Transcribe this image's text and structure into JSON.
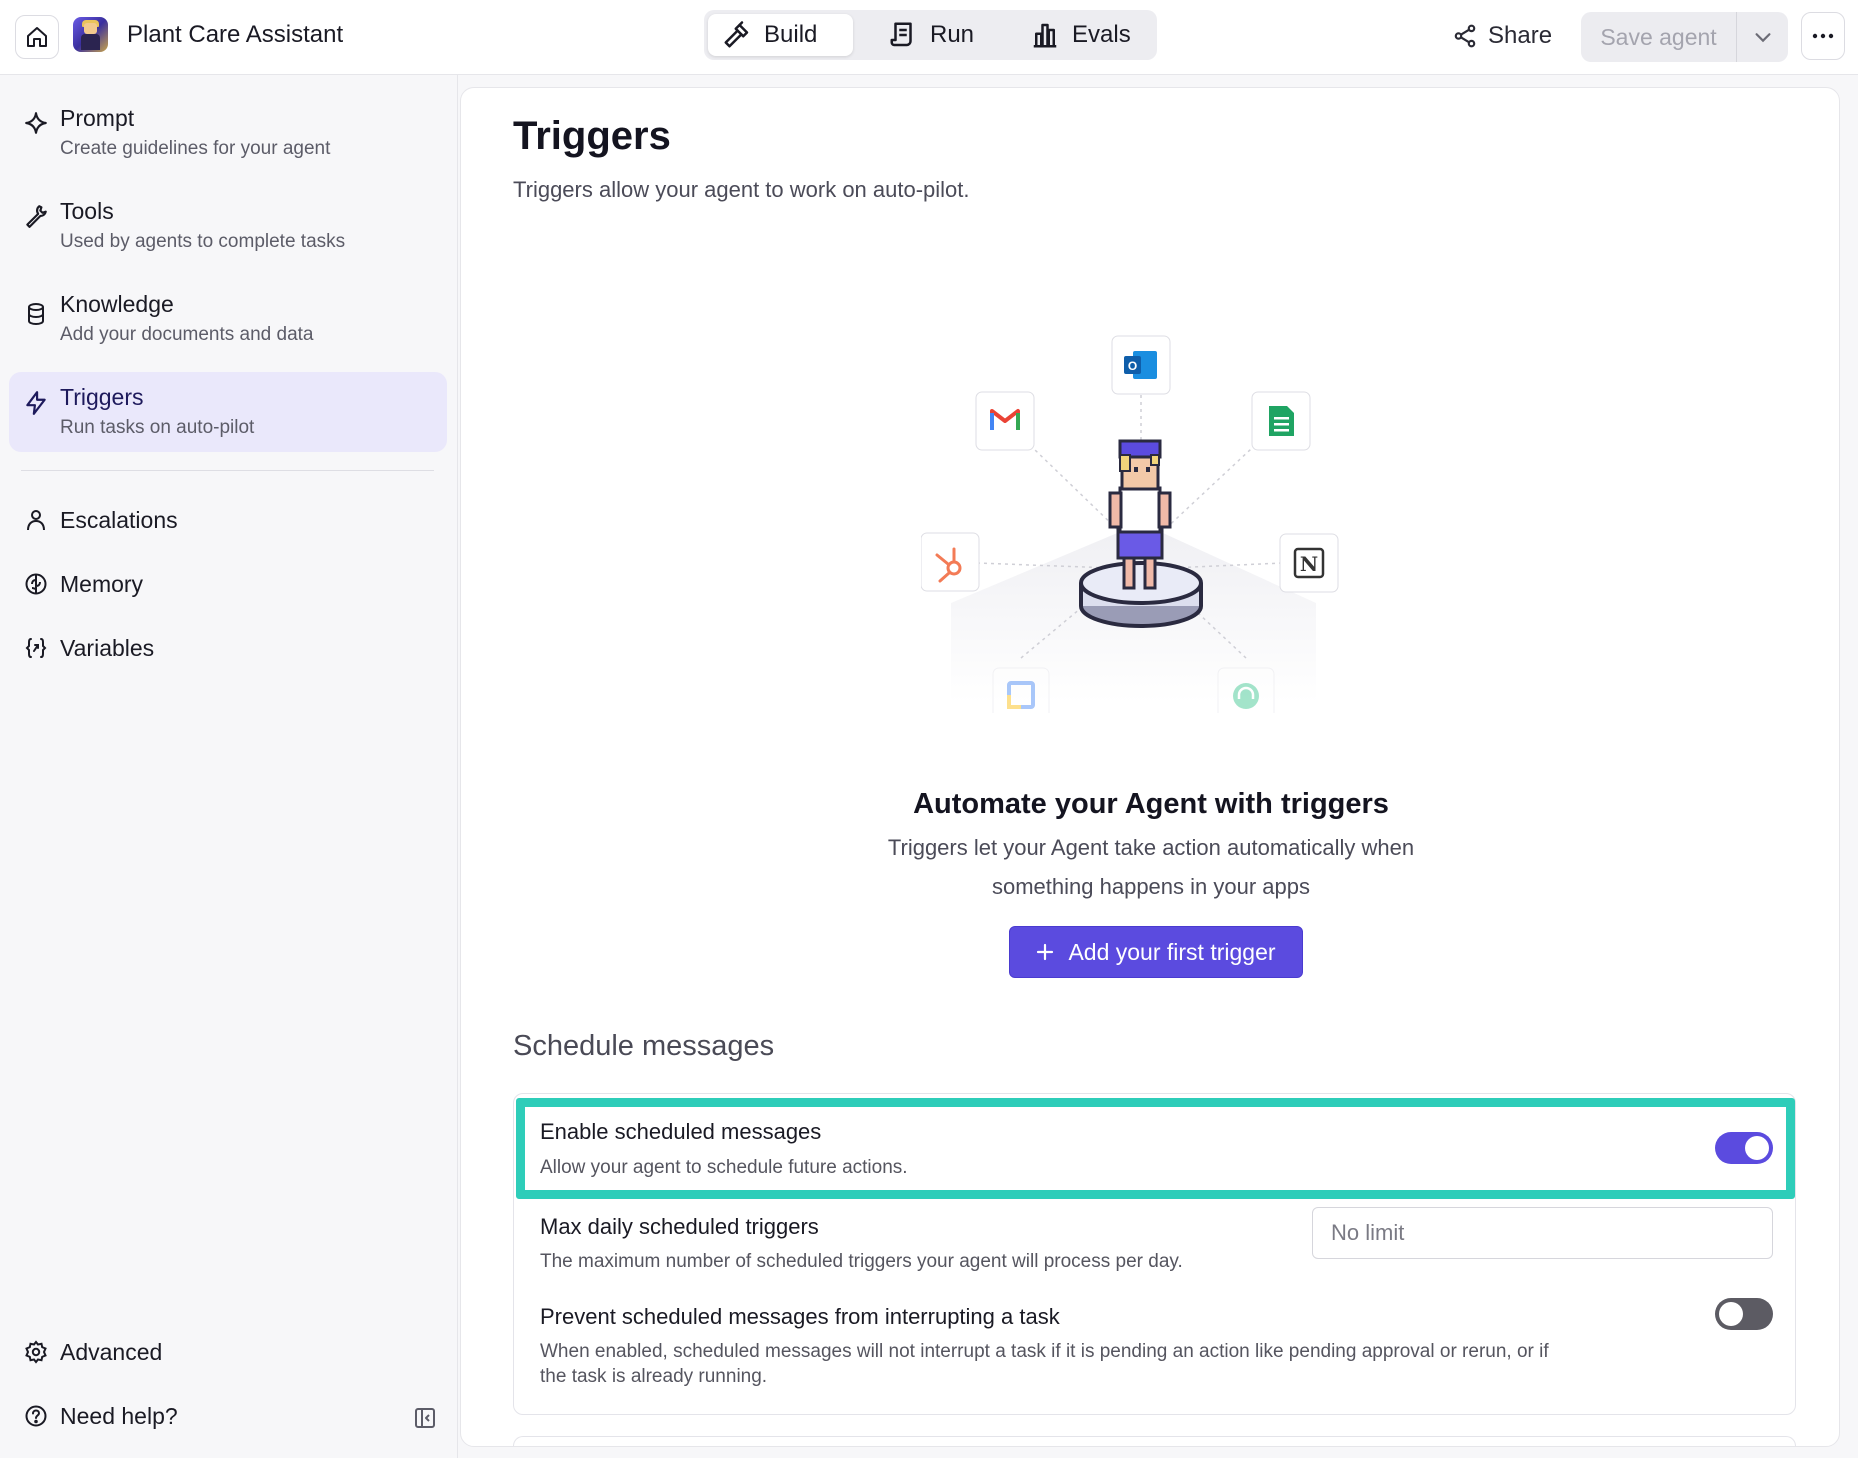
{
  "app": {
    "agent_name": "Plant Care Assistant",
    "accent_color": "#5b4bdf",
    "highlight_color": "#2ecdb9"
  },
  "header": {
    "tabs": [
      {
        "label": "Build",
        "icon": "hammer-icon",
        "active": true
      },
      {
        "label": "Run",
        "icon": "scroll-icon",
        "active": false
      },
      {
        "label": "Evals",
        "icon": "bar-chart-icon",
        "active": false
      }
    ],
    "share_label": "Share",
    "save_label": "Save agent"
  },
  "sidebar": {
    "items": [
      {
        "title": "Prompt",
        "subtitle": "Create guidelines for your agent",
        "icon": "sparkle-icon"
      },
      {
        "title": "Tools",
        "subtitle": "Used by agents to complete tasks",
        "icon": "wrench-icon"
      },
      {
        "title": "Knowledge",
        "subtitle": "Add your documents and data",
        "icon": "database-icon"
      },
      {
        "title": "Triggers",
        "subtitle": "Run tasks on auto-pilot",
        "icon": "lightning-icon",
        "active": true
      },
      {
        "title": "Escalations",
        "icon": "person-icon"
      },
      {
        "title": "Memory",
        "icon": "brain-icon"
      },
      {
        "title": "Variables",
        "icon": "variable-icon"
      }
    ],
    "footer": {
      "advanced_label": "Advanced",
      "help_label": "Need help?"
    }
  },
  "main": {
    "title": "Triggers",
    "subtitle": "Triggers allow your agent to work on auto-pilot.",
    "illustration_icons": [
      "outlook-icon",
      "gmail-icon",
      "google-sheets-icon",
      "hubspot-icon",
      "notion-icon",
      "google-docs-icon",
      "support-icon"
    ],
    "hero_title": "Automate your Agent with triggers",
    "hero_subtitle_line1": "Triggers let your Agent take action automatically when",
    "hero_subtitle_line2": "something happens in your apps",
    "add_trigger_label": "Add your first trigger",
    "schedule": {
      "section_title": "Schedule messages",
      "enable": {
        "title": "Enable scheduled messages",
        "description": "Allow your agent to schedule future actions.",
        "on": true
      },
      "max_daily": {
        "title": "Max daily scheduled triggers",
        "description": "The maximum number of scheduled triggers your agent will process per day.",
        "placeholder": "No limit"
      },
      "prevent": {
        "title": "Prevent scheduled messages from interrupting a task",
        "description_line1": "When enabled, scheduled messages will not interrupt a task if it is pending an action like pending approval or rerun, or if",
        "description_line2": "the task is already running.",
        "on": false
      }
    }
  }
}
